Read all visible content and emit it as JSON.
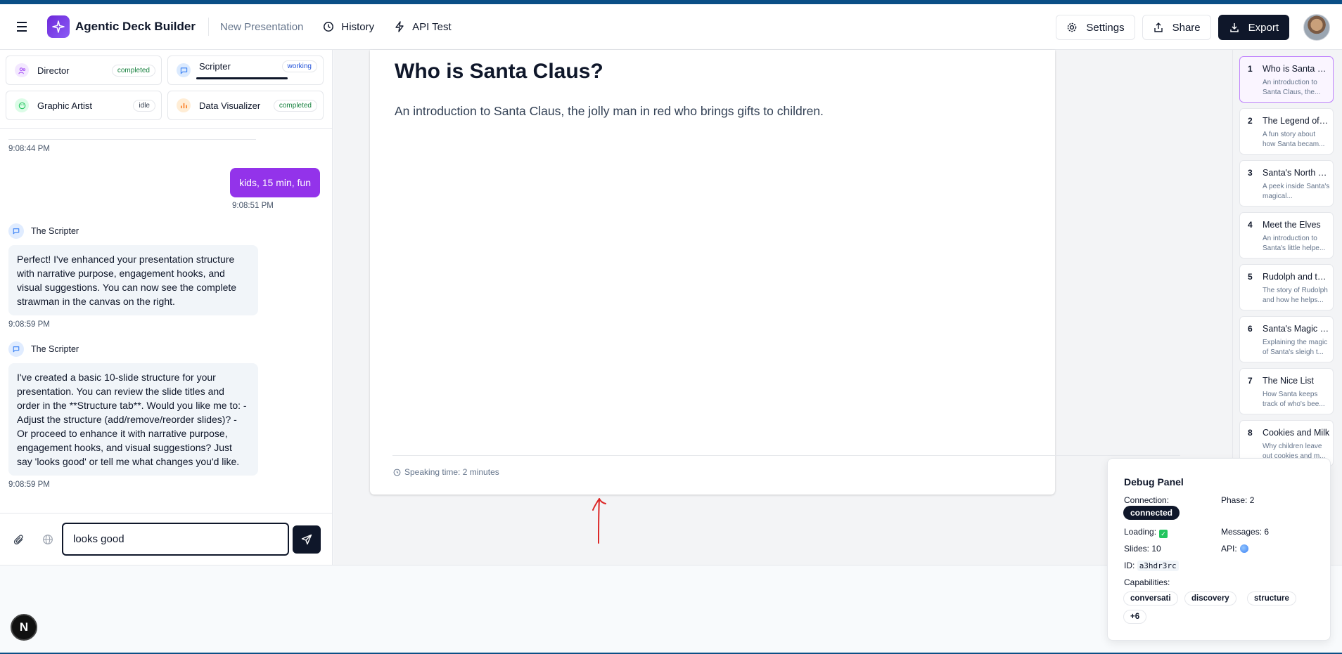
{
  "header": {
    "app_title": "Agentic Deck Builder",
    "presentation_name": "New Presentation",
    "history_label": "History",
    "api_test_label": "API Test",
    "settings_label": "Settings",
    "share_label": "Share",
    "export_label": "Export"
  },
  "agents": [
    {
      "name": "Director",
      "status": "completed",
      "color": "#a855f7"
    },
    {
      "name": "Scripter",
      "status": "working",
      "color": "#3b82f6"
    },
    {
      "name": "Graphic Artist",
      "status": "idle",
      "color": "#22c55e"
    },
    {
      "name": "Data Visualizer",
      "status": "completed",
      "color": "#f97316"
    }
  ],
  "chat": {
    "messages": [
      {
        "time": "9:08:44 PM"
      },
      {
        "role": "user",
        "text": "kids, 15 min, fun",
        "time": "9:08:51 PM"
      },
      {
        "role": "agent",
        "sender": "The Scripter",
        "text": "Perfect! I've enhanced your presentation structure with narrative purpose, engagement hooks, and visual suggestions. You can now see the complete strawman in the canvas on the right.",
        "time": "9:08:59 PM"
      },
      {
        "role": "agent",
        "sender": "The Scripter",
        "text": "I've created a basic 10-slide structure for your presentation. You can review the slide titles and order in the **Structure tab**. Would you like me to: - Adjust the structure (add/remove/reorder slides)? - Or proceed to enhance it with narrative purpose, engagement hooks, and visual suggestions? Just say 'looks good' or tell me what changes you'd like.",
        "time": "9:08:59 PM"
      }
    ],
    "input_value": "looks good"
  },
  "slide": {
    "title": "Who is Santa Claus?",
    "subtitle": "An introduction to Santa Claus, the jolly man in red who brings gifts to children.",
    "speaking_time": "Speaking time: 2 minutes"
  },
  "slides": [
    {
      "num": "1",
      "title": "Who is Santa Claus?",
      "desc": "An introduction to Santa Claus, the..."
    },
    {
      "num": "2",
      "title": "The Legend of Santa",
      "desc": "A fun story about how Santa becam..."
    },
    {
      "num": "3",
      "title": "Santa's North Pole",
      "desc": "A peek inside Santa's magical..."
    },
    {
      "num": "4",
      "title": "Meet the Elves",
      "desc": "An introduction to Santa's little helpe..."
    },
    {
      "num": "5",
      "title": "Rudolph and the Reindeer",
      "desc": "The story of Rudolph and how he helps..."
    },
    {
      "num": "6",
      "title": "Santa's Magic Sleigh",
      "desc": "Explaining the magic of Santa's sleigh t..."
    },
    {
      "num": "7",
      "title": "The Nice List",
      "desc": "How Santa keeps track of who's bee..."
    },
    {
      "num": "8",
      "title": "Cookies and Milk",
      "desc": "Why children leave out cookies and m..."
    }
  ],
  "debug": {
    "title": "Debug Panel",
    "connection_label": "Connection:",
    "connection_value": "connected",
    "phase": "Phase: 2",
    "loading_label": "Loading:",
    "messages": "Messages: 6",
    "slides": "Slides: 10",
    "api_label": "API:",
    "id_label": "ID:",
    "id_value": "a3hdr3rc",
    "capabilities_label": "Capabilities:",
    "capabilities": [
      "conversati",
      "discovery",
      "structure",
      "+6"
    ]
  },
  "misc": {
    "nextjs_badge": "N"
  }
}
